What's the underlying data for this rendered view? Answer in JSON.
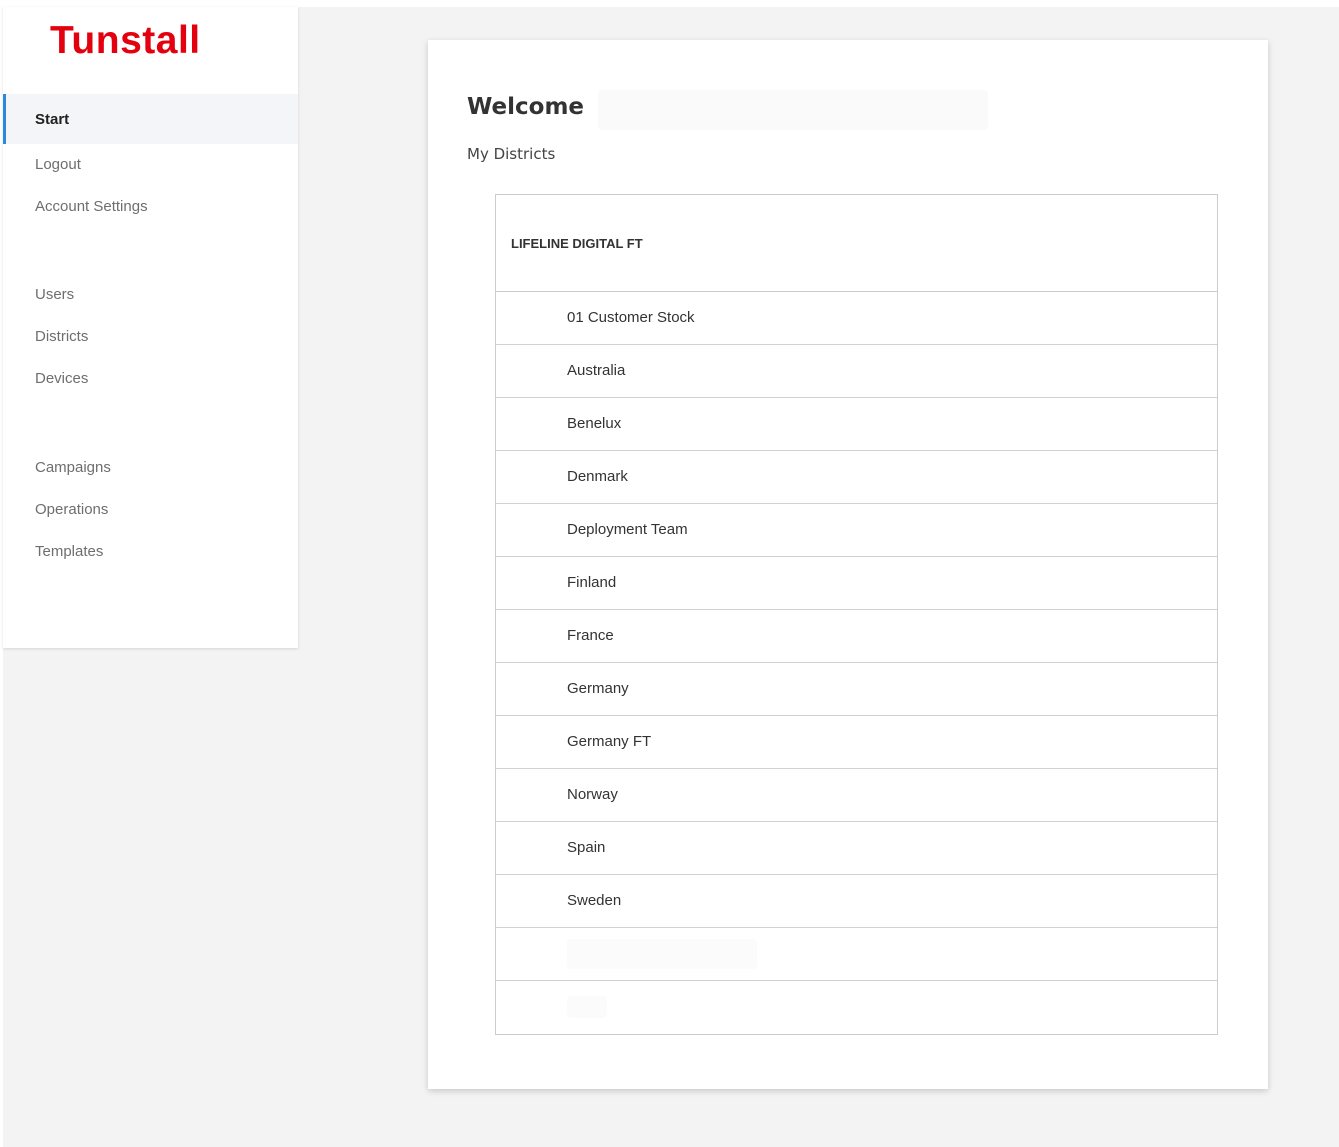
{
  "brand": {
    "logo_text": "Tunstall",
    "color": "#e3000f"
  },
  "sidebar": {
    "active_item": "Start",
    "items": [
      {
        "label": "Start"
      },
      {
        "label": "Logout"
      },
      {
        "label": "Account Settings"
      },
      {
        "label": "Users"
      },
      {
        "label": "Districts"
      },
      {
        "label": "Devices"
      },
      {
        "label": "Campaigns"
      },
      {
        "label": "Operations"
      },
      {
        "label": "Templates"
      }
    ],
    "accent_color": "#2b8ad9"
  },
  "main": {
    "title": "Welcome",
    "subtitle": "My Districts",
    "table": {
      "header": "LIFELINE DIGITAL FT",
      "rows": [
        "01 Customer Stock",
        "Australia",
        "Benelux",
        "Denmark",
        "Deployment Team",
        "Finland",
        "France",
        "Germany",
        "Germany FT",
        "Norway",
        "Spain",
        "Sweden"
      ]
    }
  }
}
